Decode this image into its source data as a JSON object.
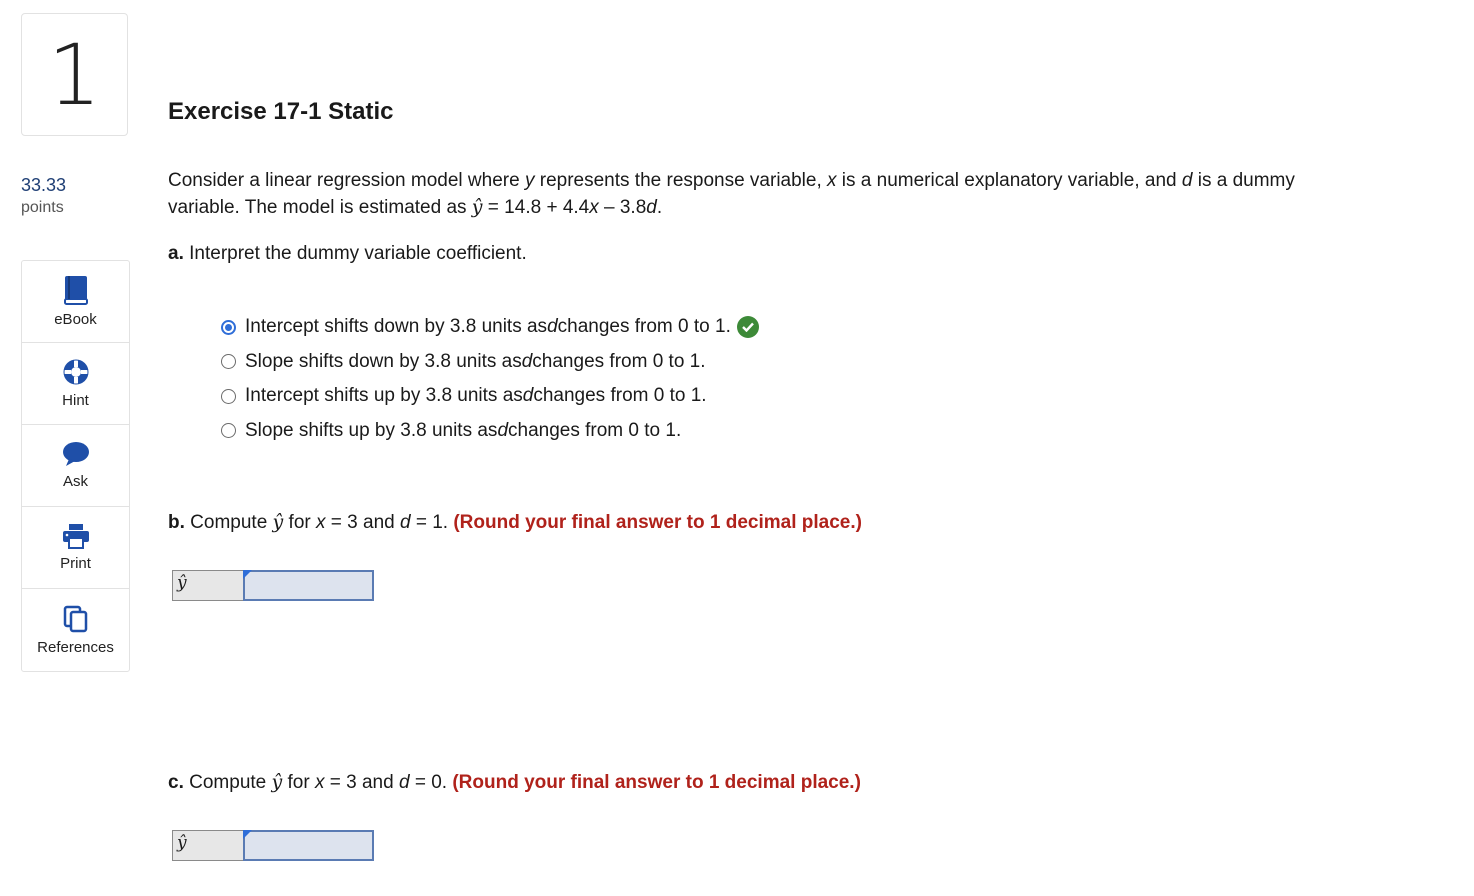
{
  "question": {
    "number": "1",
    "points_value": "33.33",
    "points_label": "points"
  },
  "sidebar_tools": [
    {
      "label": "eBook",
      "icon": "book-icon"
    },
    {
      "label": "Hint",
      "icon": "lifebuoy-icon"
    },
    {
      "label": "Ask",
      "icon": "chat-bubble-icon"
    },
    {
      "label": "Print",
      "icon": "printer-icon"
    },
    {
      "label": "References",
      "icon": "copy-documents-icon"
    }
  ],
  "title": "Exercise 17-1 Static",
  "stem": {
    "line1_a": "Consider a linear regression model where ",
    "y": "y",
    "line1_b": " represents the response variable, ",
    "x": "x",
    "line1_c": " is a numerical explanatory variable, and ",
    "d": "d",
    "line1_d": " is a dummy",
    "line2_a": "variable. The model is estimated as ",
    "yhat": "ŷ",
    "equation_a": " = 14.8 + 4.4",
    "equation_x": "x",
    "equation_b": " – 3.8",
    "equation_d": "d",
    "equation_end": "."
  },
  "part_a": {
    "label": "a.",
    "text": " Interpret the dummy variable coefficient.",
    "options": [
      {
        "pre": "Intercept shifts down by 3.8 units as ",
        "var": "d",
        "post": " changes from 0 to 1.",
        "selected": true,
        "correct": true
      },
      {
        "pre": "Slope shifts down by 3.8 units as ",
        "var": "d",
        "post": " changes from 0 to 1.",
        "selected": false,
        "correct": false
      },
      {
        "pre": "Intercept shifts up by 3.8 units as ",
        "var": "d",
        "post": " changes from 0 to 1.",
        "selected": false,
        "correct": false
      },
      {
        "pre": "Slope shifts up by 3.8 units as ",
        "var": "d",
        "post": " changes from 0 to 1.",
        "selected": false,
        "correct": false
      }
    ]
  },
  "part_b": {
    "label": "b.",
    "compute": " Compute ",
    "yhat": "ŷ",
    "for": " for ",
    "x": "x",
    "x_eq": " = 3 and ",
    "d": "d",
    "d_eq": " = 1. ",
    "round_note": "(Round your final answer to 1 decimal place.)",
    "answer_label": "ŷ",
    "answer_value": ""
  },
  "part_c": {
    "label": "c.",
    "compute": " Compute ",
    "yhat": "ŷ",
    "for": " for ",
    "x": "x",
    "x_eq": " = 3 and ",
    "d": "d",
    "d_eq": " = 0. ",
    "round_note": "(Round your final answer to 1 decimal place.)",
    "answer_label": "ŷ",
    "answer_value": ""
  },
  "colors": {
    "accent_blue": "#2f6ed8",
    "correct_green": "#3d8a38",
    "round_red": "#b0221b",
    "points_blue": "#1f3f75"
  }
}
